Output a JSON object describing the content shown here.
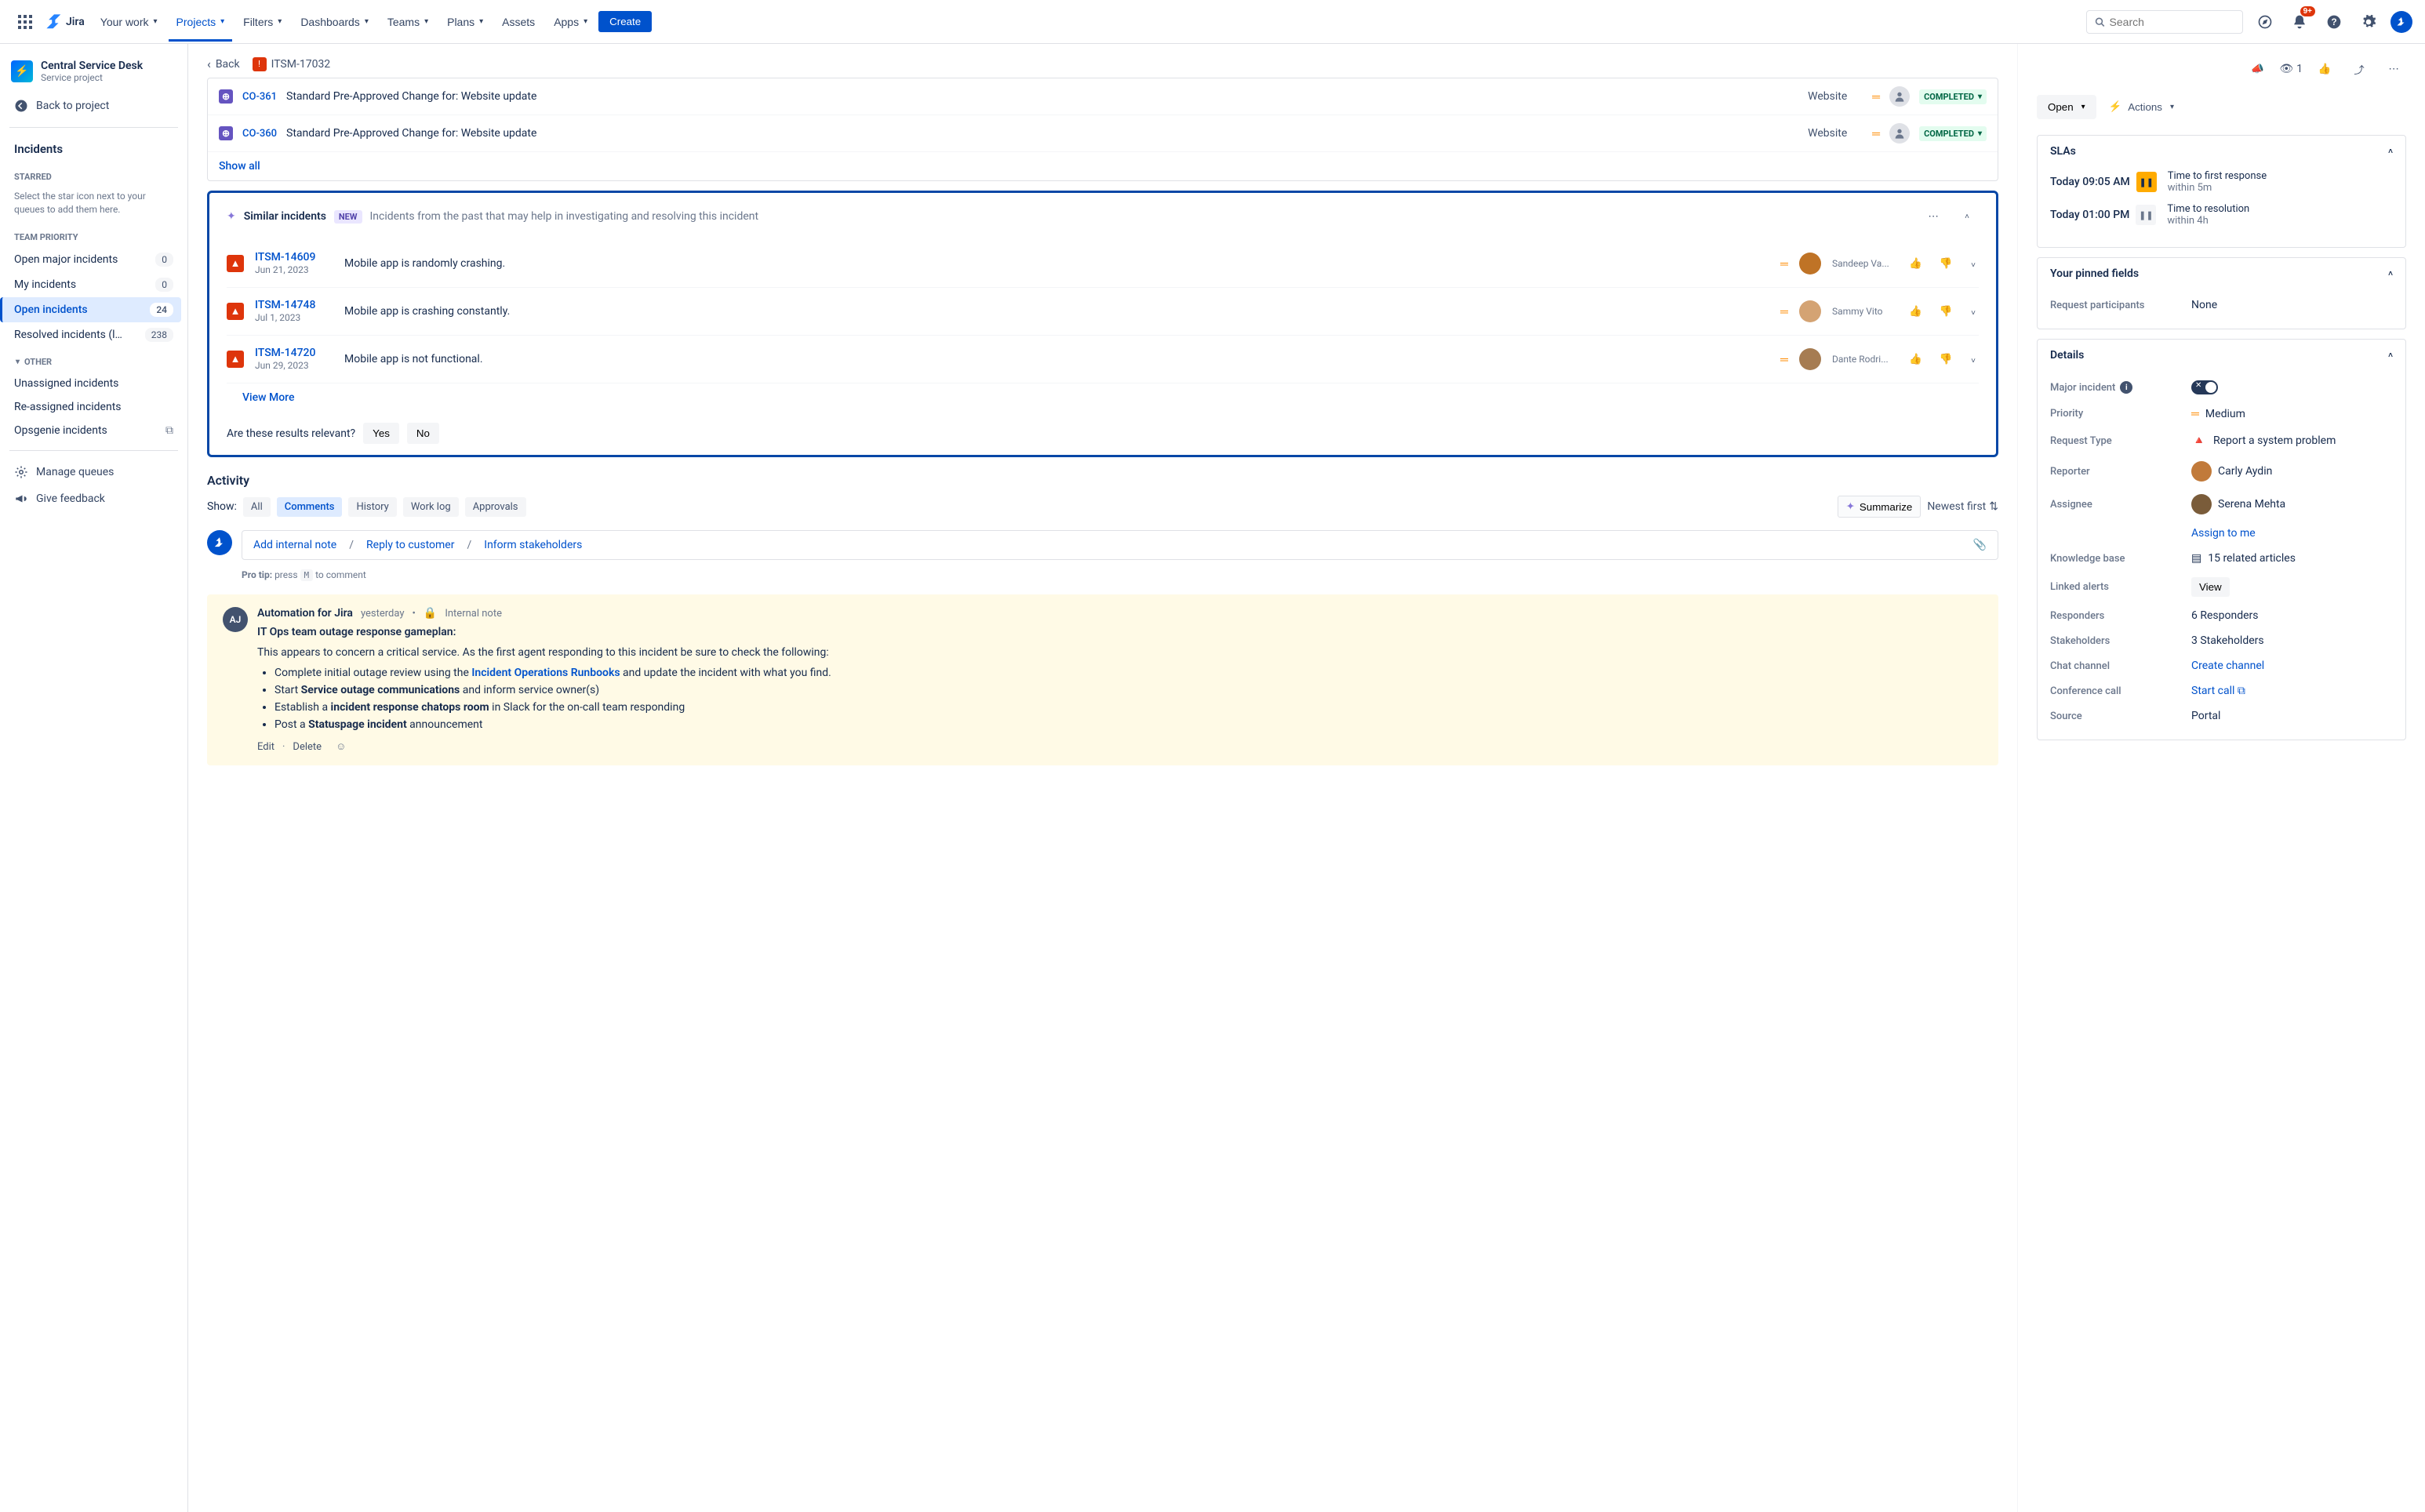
{
  "topnav": {
    "logo": "Jira",
    "items": [
      "Your work",
      "Projects",
      "Filters",
      "Dashboards",
      "Teams",
      "Plans",
      "Assets",
      "Apps"
    ],
    "activeIndex": 1,
    "create": "Create",
    "search_placeholder": "Search",
    "notif_badge": "9+"
  },
  "sidebar": {
    "project_name": "Central Service Desk",
    "project_type": "Service project",
    "back": "Back to project",
    "incidents": "Incidents",
    "starred_label": "STARRED",
    "starred_hint": "Select the star icon next to your queues to add them here.",
    "team_prio_label": "TEAM PRIORITY",
    "queues": [
      {
        "name": "Open major incidents",
        "count": "0"
      },
      {
        "name": "My incidents",
        "count": "0"
      },
      {
        "name": "Open incidents",
        "count": "24",
        "active": true
      },
      {
        "name": "Resolved incidents (la...",
        "count": "238"
      }
    ],
    "other_label": "OTHER",
    "other_items": [
      "Unassigned incidents",
      "Re-assigned incidents",
      "Opsgenie incidents"
    ],
    "manage_queues": "Manage queues",
    "give_feedback": "Give feedback"
  },
  "header": {
    "back": "Back",
    "issue_key": "ITSM-17032"
  },
  "linked": {
    "rows": [
      {
        "key": "CO-361",
        "title": "Standard Pre-Approved Change for: Website update",
        "category": "Website",
        "status": "COMPLETED"
      },
      {
        "key": "CO-360",
        "title": "Standard Pre-Approved Change for: Website update",
        "category": "Website",
        "status": "COMPLETED"
      }
    ],
    "show_all": "Show all"
  },
  "similar": {
    "title": "Similar incidents",
    "badge": "NEW",
    "desc": "Incidents from the past that may help in investigating and resolving this incident",
    "rows": [
      {
        "key": "ITSM-14609",
        "date": "Jun 21, 2023",
        "summary": "Mobile app is randomly crashing.",
        "assignee": "Sandeep Va..."
      },
      {
        "key": "ITSM-14748",
        "date": "Jul 1, 2023",
        "summary": "Mobile app is crashing constantly.",
        "assignee": "Sammy Vito"
      },
      {
        "key": "ITSM-14720",
        "date": "Jun 29, 2023",
        "summary": "Mobile app is not functional.",
        "assignee": "Dante Rodri..."
      }
    ],
    "view_more": "View More",
    "relevance_q": "Are these results relevant?",
    "yes": "Yes",
    "no": "No"
  },
  "activity": {
    "title": "Activity",
    "show": "Show:",
    "tabs": [
      "All",
      "Comments",
      "History",
      "Work log",
      "Approvals"
    ],
    "active_tab": 1,
    "summarize": "Summarize",
    "sort": "Newest first",
    "add_internal": "Add internal note",
    "reply": "Reply to customer",
    "inform": "Inform stakeholders",
    "protip_pre": "Pro tip:",
    "protip_press": "press",
    "protip_key": "M",
    "protip_post": "to comment"
  },
  "comment": {
    "author": "Automation for Jira",
    "time": "yesterday",
    "internal": "Internal note",
    "heading": "IT Ops team outage response gameplan:",
    "intro": "This appears to concern a critical service. As the first agent responding to this incident be sure to check the following:",
    "b1_pre": "Complete initial outage review using the ",
    "b1_link": "Incident Operations Runbooks",
    "b1_post": " and update the incident with what you find.",
    "b2_pre": "Start ",
    "b2_bold": "Service outage communications",
    "b2_post": " and inform service owner(s)",
    "b3_pre": "Establish a ",
    "b3_bold": "incident response chatops room",
    "b3_post": " in Slack for the on-call team responding",
    "b4_pre": "Post a ",
    "b4_bold": "Statuspage incident",
    "b4_post": " announcement",
    "edit": "Edit",
    "delete": "Delete"
  },
  "rightpanel": {
    "watchers": "1",
    "status": "Open",
    "actions": "Actions",
    "slas_title": "SLAs",
    "sla1_time": "Today 09:05 AM",
    "sla1_label": "Time to first response",
    "sla1_sub": "within 5m",
    "sla2_time": "Today 01:00 PM",
    "sla2_label": "Time to resolution",
    "sla2_sub": "within 4h",
    "pinned_title": "Your pinned fields",
    "req_participants_label": "Request participants",
    "req_participants_val": "None",
    "details_title": "Details",
    "fields": {
      "major_incident": "Major incident",
      "priority": "Priority",
      "priority_val": "Medium",
      "request_type": "Request Type",
      "request_type_val": "Report a system problem",
      "reporter": "Reporter",
      "reporter_val": "Carly Aydin",
      "assignee": "Assignee",
      "assignee_val": "Serena Mehta",
      "assign_to_me": "Assign to me",
      "kb": "Knowledge base",
      "kb_val": "15 related articles",
      "linked_alerts": "Linked alerts",
      "linked_alerts_val": "View",
      "responders": "Responders",
      "responders_val": "6 Responders",
      "stakeholders": "Stakeholders",
      "stakeholders_val": "3 Stakeholders",
      "chat": "Chat channel",
      "chat_val": "Create channel",
      "conf": "Conference call",
      "conf_val": "Start call",
      "source": "Source",
      "source_val": "Portal"
    }
  }
}
